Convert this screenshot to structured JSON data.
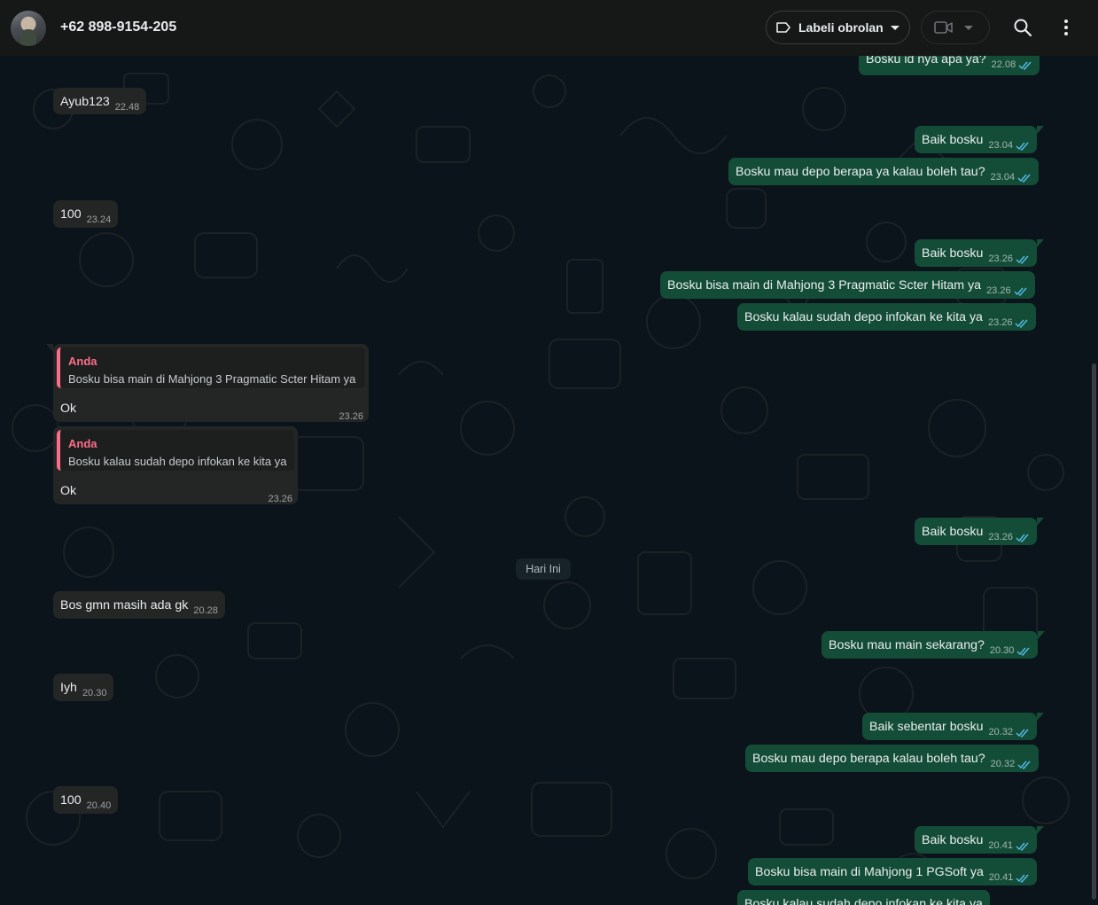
{
  "header": {
    "contact_name": "+62 898-9154-205",
    "label_button": "Labeli obrolan",
    "icons": [
      "avatar",
      "label-icon",
      "video-call-icon",
      "search-icon",
      "menu-icon"
    ]
  },
  "date_divider": "Hari Ini",
  "messages": [
    {
      "dir": "out",
      "text": "Bosku id nya apa ya?",
      "time": "22.08",
      "status": "read"
    },
    {
      "dir": "in",
      "text": "Ayub123",
      "time": "22.48"
    },
    {
      "dir": "out",
      "text": "Baik bosku",
      "time": "23.04",
      "status": "read"
    },
    {
      "dir": "out",
      "text": "Bosku mau depo berapa ya kalau boleh tau?",
      "time": "23.04",
      "status": "read"
    },
    {
      "dir": "in",
      "text": "100",
      "time": "23.24"
    },
    {
      "dir": "out",
      "text": "Baik bosku",
      "time": "23.26",
      "status": "read"
    },
    {
      "dir": "out",
      "text": "Bosku bisa main di Mahjong 3 Pragmatic Scter Hitam ya",
      "time": "23.26",
      "status": "read"
    },
    {
      "dir": "out",
      "text": "Bosku kalau sudah depo infokan ke kita ya",
      "time": "23.26",
      "status": "read"
    },
    {
      "dir": "in",
      "reply_to": {
        "author": "Anda",
        "text": "Bosku bisa main di Mahjong 3 Pragmatic Scter Hitam ya"
      },
      "text": "Ok",
      "time": "23.26"
    },
    {
      "dir": "in",
      "reply_to": {
        "author": "Anda",
        "text": "Bosku kalau sudah depo infokan ke kita ya"
      },
      "text": "Ok",
      "time": "23.26"
    },
    {
      "dir": "out",
      "text": "Baik bosku",
      "time": "23.26",
      "status": "read"
    },
    {
      "dir": "in",
      "text": "Bos gmn masih ada gk",
      "time": "20.28"
    },
    {
      "dir": "out",
      "text": "Bosku mau main sekarang?",
      "time": "20.30",
      "status": "read"
    },
    {
      "dir": "in",
      "text": "Iyh",
      "time": "20.30"
    },
    {
      "dir": "out",
      "text": "Baik sebentar bosku",
      "time": "20.32",
      "status": "read"
    },
    {
      "dir": "out",
      "text": "Bosku mau depo berapa kalau boleh tau?",
      "time": "20.32",
      "status": "read"
    },
    {
      "dir": "in",
      "text": "100",
      "time": "20.40"
    },
    {
      "dir": "out",
      "text": "Baik bosku",
      "time": "20.41",
      "status": "read"
    },
    {
      "dir": "out",
      "text": "Bosku bisa main di Mahjong 1 PGSoft ya",
      "time": "20.41",
      "status": "read"
    },
    {
      "dir": "out",
      "text": "Bosku kalau sudah depo infokan ke kita ya",
      "time": "",
      "status": "read"
    }
  ],
  "colors": {
    "incoming_bubble": "#242626",
    "outgoing_bubble": "#144d37",
    "quote_accent": "#fc6d8a",
    "tick_read": "#53bdeb"
  }
}
